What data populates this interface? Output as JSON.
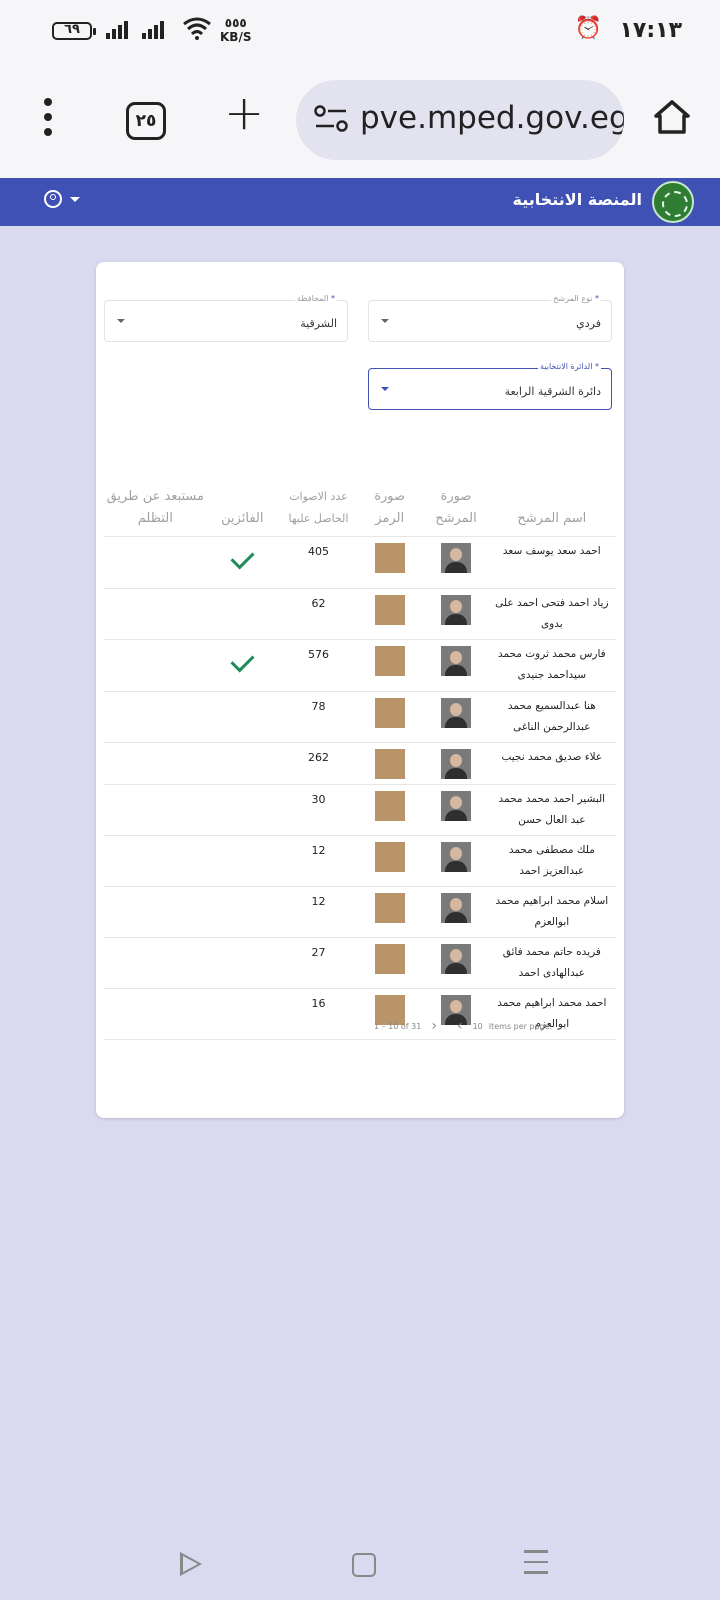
{
  "status_bar": {
    "time": "١٧:١٣",
    "battery": "٦٩",
    "net_speed_value": "٥٥٥",
    "net_speed_unit": "KB/S"
  },
  "browser": {
    "url": "pve.mped.gov.eg/",
    "tab_count": "٢٥"
  },
  "app_header": {
    "title": "المنصة الانتخابية"
  },
  "filters": {
    "candidate_type": {
      "label": "نوع المرشح",
      "value": "فردي"
    },
    "governorate": {
      "label": "المحافظة",
      "value": "الشرقية"
    },
    "district": {
      "label": "الدائرة الانتخابية",
      "value": "دائرة الشرقية الرابعة"
    },
    "required_mark": "*"
  },
  "table": {
    "headers": {
      "name": "اسم المرشح",
      "photo": "صورة المرشح",
      "symbol": "صورة الرمز",
      "votes": "عدد الاصوات الحاصل عليها",
      "winners": "الفائزين",
      "excluded": "مستبعد عن طريق التظلم"
    },
    "rows": [
      {
        "name": "احمد سعد يوسف سعد",
        "votes": "405",
        "winner": true
      },
      {
        "name": "زياد احمد فتحى احمد على بدوى",
        "votes": "62",
        "winner": false
      },
      {
        "name": "فارس محمد ثروت محمد سيداحمد جنيدى",
        "votes": "576",
        "winner": true
      },
      {
        "name": "هنا عبدالسميع محمد عبدالرحمن الناغى",
        "votes": "78",
        "winner": false
      },
      {
        "name": "علاء صديق محمد نجيب",
        "votes": "262",
        "winner": false
      },
      {
        "name": "البشير احمد محمد محمد عبد العال حسن",
        "votes": "30",
        "winner": false
      },
      {
        "name": "ملك مصطفى محمد عبدالعزيز احمد",
        "votes": "12",
        "winner": false
      },
      {
        "name": "اسلام محمد ابراهيم محمد ابوالعزم",
        "votes": "12",
        "winner": false
      },
      {
        "name": "فريده حاتم محمد فائق عبدالهادى احمد",
        "votes": "27",
        "winner": false
      },
      {
        "name": "احمد محمد ابراهيم محمد ابوالعزم",
        "votes": "16",
        "winner": false
      }
    ]
  },
  "paginator": {
    "items_per_page_label": "Items per page:",
    "page_size": "10",
    "range": "1 – 10 of 31"
  }
}
